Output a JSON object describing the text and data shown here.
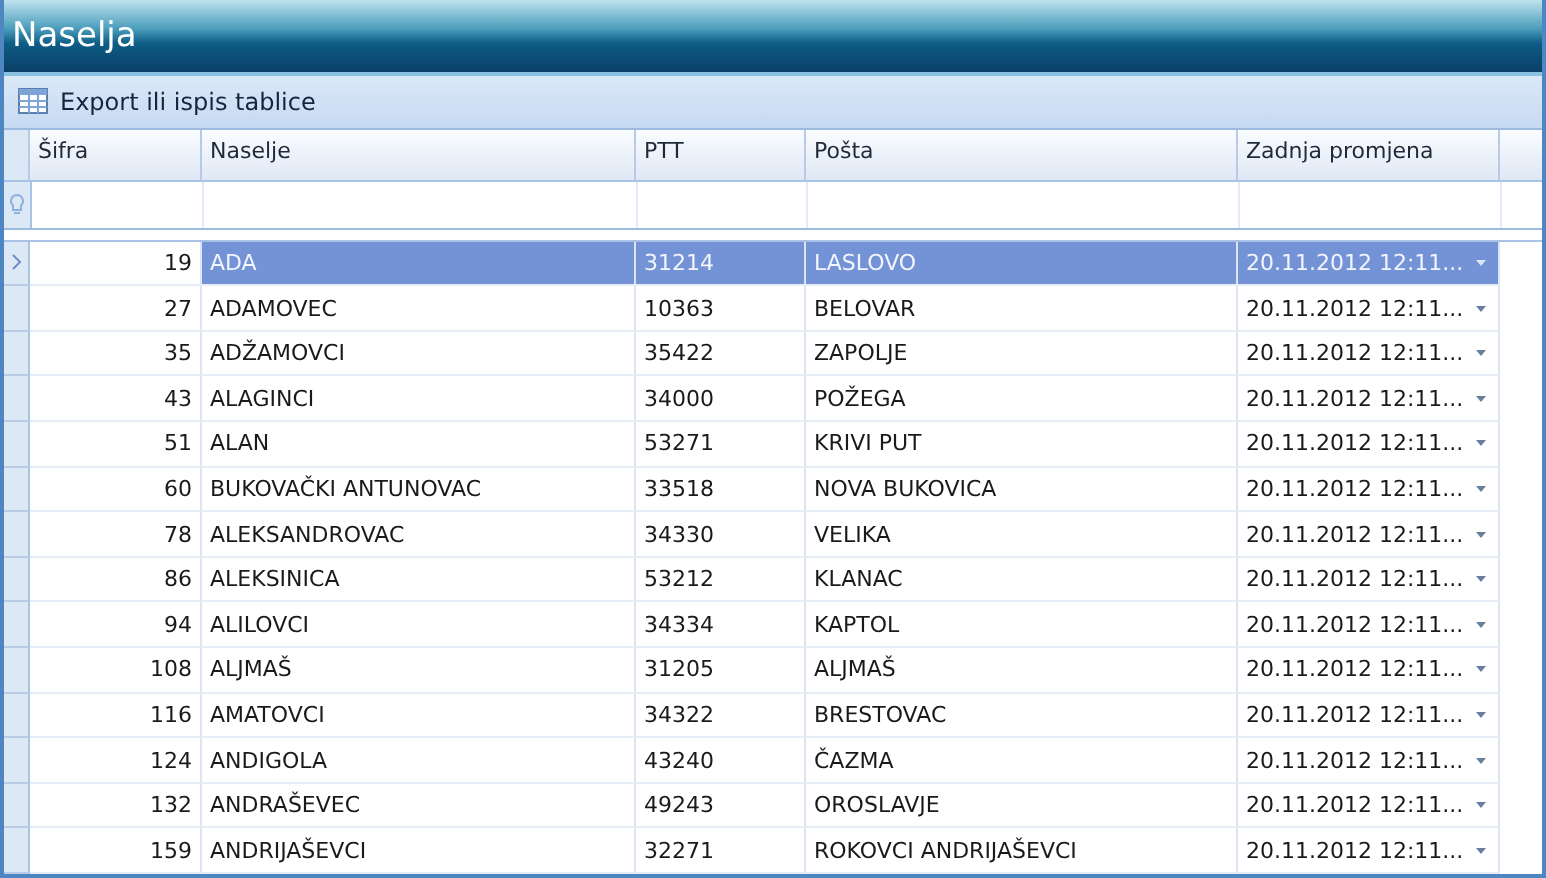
{
  "window": {
    "title": "Naselja"
  },
  "toolbar": {
    "export_button": "Export ili ispis tablice"
  },
  "table": {
    "columns": [
      "Šifra",
      "Naselje",
      "PTT",
      "Pošta",
      "Zadnja promjena"
    ],
    "rows": [
      {
        "sifra": "19",
        "naselje": "ADA",
        "ptt": "31214",
        "posta": "LASLOVO",
        "zadnja_promjena": "20.11.2012 12:11...",
        "selected": true
      },
      {
        "sifra": "27",
        "naselje": "ADAMOVEC",
        "ptt": "10363",
        "posta": "BELOVAR",
        "zadnja_promjena": "20.11.2012 12:11...",
        "selected": false
      },
      {
        "sifra": "35",
        "naselje": "ADŽAMOVCI",
        "ptt": "35422",
        "posta": "ZAPOLJE",
        "zadnja_promjena": "20.11.2012 12:11...",
        "selected": false
      },
      {
        "sifra": "43",
        "naselje": "ALAGINCI",
        "ptt": "34000",
        "posta": "POŽEGA",
        "zadnja_promjena": "20.11.2012 12:11...",
        "selected": false
      },
      {
        "sifra": "51",
        "naselje": "ALAN",
        "ptt": "53271",
        "posta": "KRIVI PUT",
        "zadnja_promjena": "20.11.2012 12:11...",
        "selected": false
      },
      {
        "sifra": "60",
        "naselje": "BUKOVAČKI ANTUNOVAC",
        "ptt": "33518",
        "posta": "NOVA BUKOVICA",
        "zadnja_promjena": "20.11.2012 12:11...",
        "selected": false
      },
      {
        "sifra": "78",
        "naselje": "ALEKSANDROVAC",
        "ptt": "34330",
        "posta": "VELIKA",
        "zadnja_promjena": "20.11.2012 12:11...",
        "selected": false
      },
      {
        "sifra": "86",
        "naselje": "ALEKSINICA",
        "ptt": "53212",
        "posta": "KLANAC",
        "zadnja_promjena": "20.11.2012 12:11...",
        "selected": false
      },
      {
        "sifra": "94",
        "naselje": "ALILOVCI",
        "ptt": "34334",
        "posta": "KAPTOL",
        "zadnja_promjena": "20.11.2012 12:11...",
        "selected": false
      },
      {
        "sifra": "108",
        "naselje": "ALJMAŠ",
        "ptt": "31205",
        "posta": "ALJMAŠ",
        "zadnja_promjena": "20.11.2012 12:11...",
        "selected": false
      },
      {
        "sifra": "116",
        "naselje": "AMATOVCI",
        "ptt": "34322",
        "posta": "BRESTOVAC",
        "zadnja_promjena": "20.11.2012 12:11...",
        "selected": false
      },
      {
        "sifra": "124",
        "naselje": "ANDIGOLA",
        "ptt": "43240",
        "posta": "ČAZMA",
        "zadnja_promjena": "20.11.2012 12:11...",
        "selected": false
      },
      {
        "sifra": "132",
        "naselje": "ANDRAŠEVEC",
        "ptt": "49243",
        "posta": "OROSLAVJE",
        "zadnja_promjena": "20.11.2012 12:11...",
        "selected": false
      },
      {
        "sifra": "159",
        "naselje": "ANDRIJAŠEVCI",
        "ptt": "32271",
        "posta": "ROKOVCI ANDRIJAŠEVCI",
        "zadnja_promjena": "20.11.2012 12:11...",
        "selected": false
      }
    ]
  }
}
